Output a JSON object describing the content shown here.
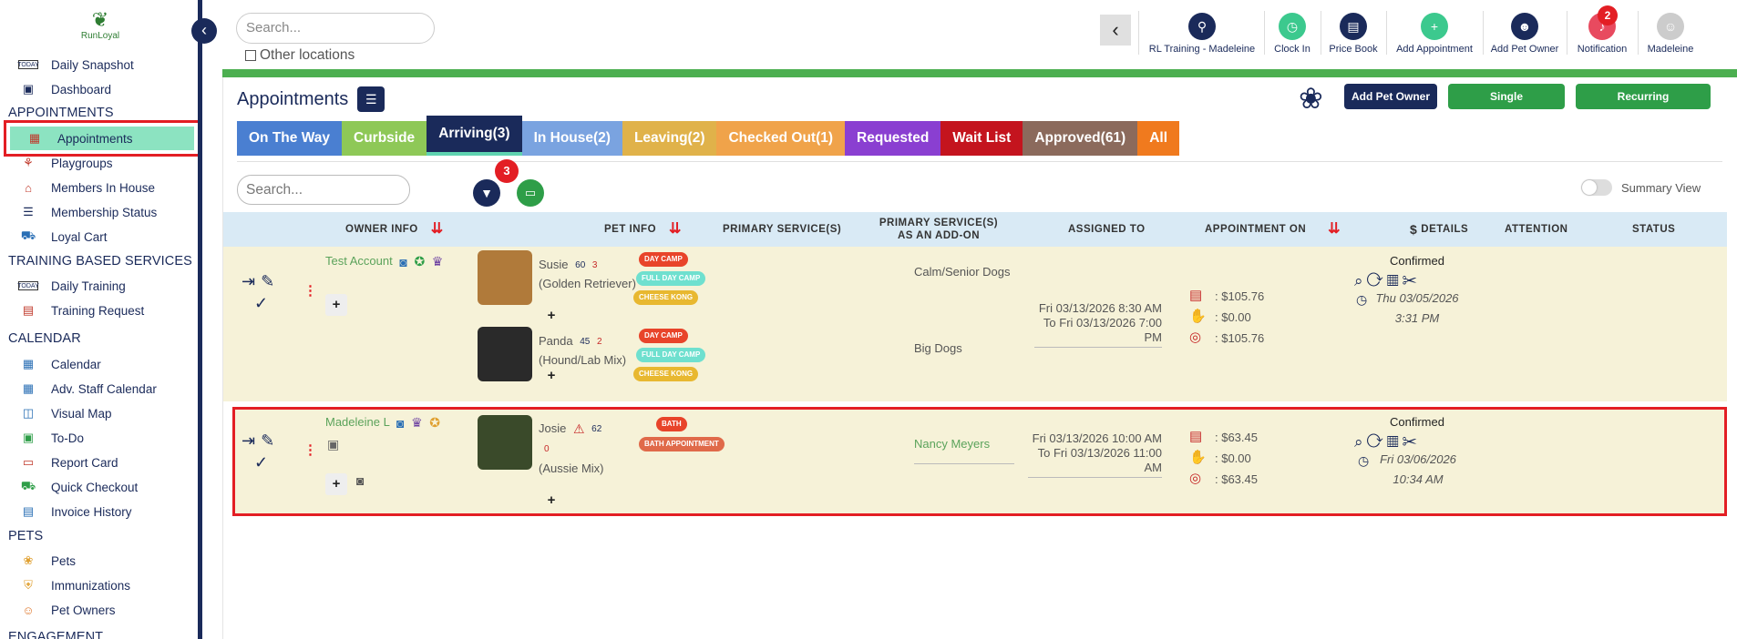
{
  "logo": {
    "text": "RunLoyal"
  },
  "sidebar": {
    "items": [
      {
        "label": "Daily Snapshot",
        "icon": "today-icon"
      },
      {
        "label": "Dashboard",
        "icon": "dashboard-icon"
      },
      {
        "section": "APPOINTMENTS"
      },
      {
        "label": "Appointments",
        "icon": "calendar-grid-icon",
        "active": true
      },
      {
        "label": "Playgroups",
        "icon": "playgroups-icon"
      },
      {
        "label": "Members In House",
        "icon": "house-icon"
      },
      {
        "label": "Membership Status",
        "icon": "membership-icon"
      },
      {
        "label": "Loyal Cart",
        "icon": "cart-icon"
      },
      {
        "section": "TRAINING BASED SERVICES"
      },
      {
        "label": "Daily Training",
        "icon": "today-icon"
      },
      {
        "label": "Training Request",
        "icon": "training-request-icon"
      },
      {
        "section": "CALENDAR"
      },
      {
        "label": "Calendar",
        "icon": "calendar-icon"
      },
      {
        "label": "Adv. Staff Calendar",
        "icon": "staff-calendar-icon"
      },
      {
        "label": "Visual Map",
        "icon": "map-icon"
      },
      {
        "label": "To-Do",
        "icon": "todo-icon"
      },
      {
        "label": "Report Card",
        "icon": "report-card-icon"
      },
      {
        "label": "Quick Checkout",
        "icon": "checkout-cart-icon"
      },
      {
        "label": "Invoice History",
        "icon": "invoice-icon"
      },
      {
        "section": "PETS"
      },
      {
        "label": "Pets",
        "icon": "paw-icon"
      },
      {
        "label": "Immunizations",
        "icon": "shield-icon"
      },
      {
        "label": "Pet Owners",
        "icon": "user-icon"
      },
      {
        "section": "ENGAGEMENT"
      }
    ]
  },
  "topbar": {
    "search_placeholder": "Search...",
    "other_locations": "Other locations",
    "actions": [
      {
        "label": "RL Training - Madeleine",
        "color": "#1a2a5a"
      },
      {
        "label": "Clock In",
        "color": "#3cc98e"
      },
      {
        "label": "Price Book",
        "color": "#1a2a5a"
      },
      {
        "label": "Add Appointment",
        "color": "#3cc98e"
      },
      {
        "label": "Add Pet Owner",
        "color": "#1a2a5a"
      },
      {
        "label": "Notification",
        "color": "#e84a5f",
        "badge": "2"
      },
      {
        "label": "Madeleine",
        "color": "#cccccc"
      }
    ]
  },
  "main": {
    "title": "Appointments",
    "buttons": {
      "add_pet_owner": "Add Pet Owner",
      "single": "Single Appointment",
      "recurring": "Recurring Appointment"
    },
    "tabs": [
      {
        "label": "On The Way",
        "color": "#4a7fd1"
      },
      {
        "label": "Curbside",
        "color": "#8ec857"
      },
      {
        "label": "Arriving(3)",
        "color": "#1a2a5a"
      },
      {
        "label": "In House(2)",
        "color": "#7aa3e0"
      },
      {
        "label": "Leaving(2)",
        "color": "#e0b24a"
      },
      {
        "label": "Checked Out(1)",
        "color": "#f0a34a"
      },
      {
        "label": "Requested",
        "color": "#8a3fd1"
      },
      {
        "label": "Wait List",
        "color": "#c4141e"
      },
      {
        "label": "Approved(61)",
        "color": "#8b6a5c"
      },
      {
        "label": "All",
        "color": "#f07a1e"
      }
    ],
    "search_placeholder": "Search...",
    "filter_badge": "3",
    "summary_view": "Summary View",
    "columns": {
      "owner": "OWNER INFO",
      "pet": "PET INFO",
      "primary": "PRIMARY SERVICE(S)",
      "addon": "PRIMARY SERVICE(S) AS AN ADD-ON",
      "assigned": "ASSIGNED TO",
      "appt_on": "APPOINTMENT ON",
      "details": "DETAILS",
      "attention": "ATTENTION",
      "status": "STATUS"
    },
    "rows": [
      {
        "owner": "Test Account",
        "pets": [
          {
            "name": "Susie",
            "weight": "60",
            "count": "3",
            "breed": "(Golden Retriever)",
            "services": [
              "DAY CAMP",
              "FULL DAY CAMP",
              "CHEESE KONG"
            ],
            "assigned": "Calm/Senior Dogs"
          },
          {
            "name": "Panda",
            "weight": "45",
            "count": "2",
            "breed": "(Hound/Lab Mix)",
            "services": [
              "DAY CAMP",
              "FULL DAY CAMP",
              "CHEESE KONG"
            ],
            "assigned": "Big Dogs"
          }
        ],
        "appt_from": "Fri 03/13/2026 8:30 AM",
        "appt_to": "To Fri 03/13/2026 7:00 PM",
        "amounts": [
          ": $105.76",
          ": $0.00",
          ": $105.76"
        ],
        "status": "Confirmed",
        "status_date": "Thu 03/05/2026",
        "status_time": "3:31 PM"
      },
      {
        "owner": "Madeleine L",
        "pets": [
          {
            "name": "Josie",
            "weight": "62",
            "count": "0",
            "breed": "(Aussie Mix)",
            "services": [
              "BATH",
              "BATH APPOINTMENT"
            ],
            "assigned": "Nancy Meyers"
          }
        ],
        "appt_from": "Fri 03/13/2026 10:00 AM",
        "appt_to": "To Fri 03/13/2026 11:00 AM",
        "amounts": [
          ": $63.45",
          ": $0.00",
          ": $63.45"
        ],
        "status": "Confirmed",
        "status_date": "Fri 03/06/2026",
        "status_time": "10:34 AM"
      }
    ]
  }
}
